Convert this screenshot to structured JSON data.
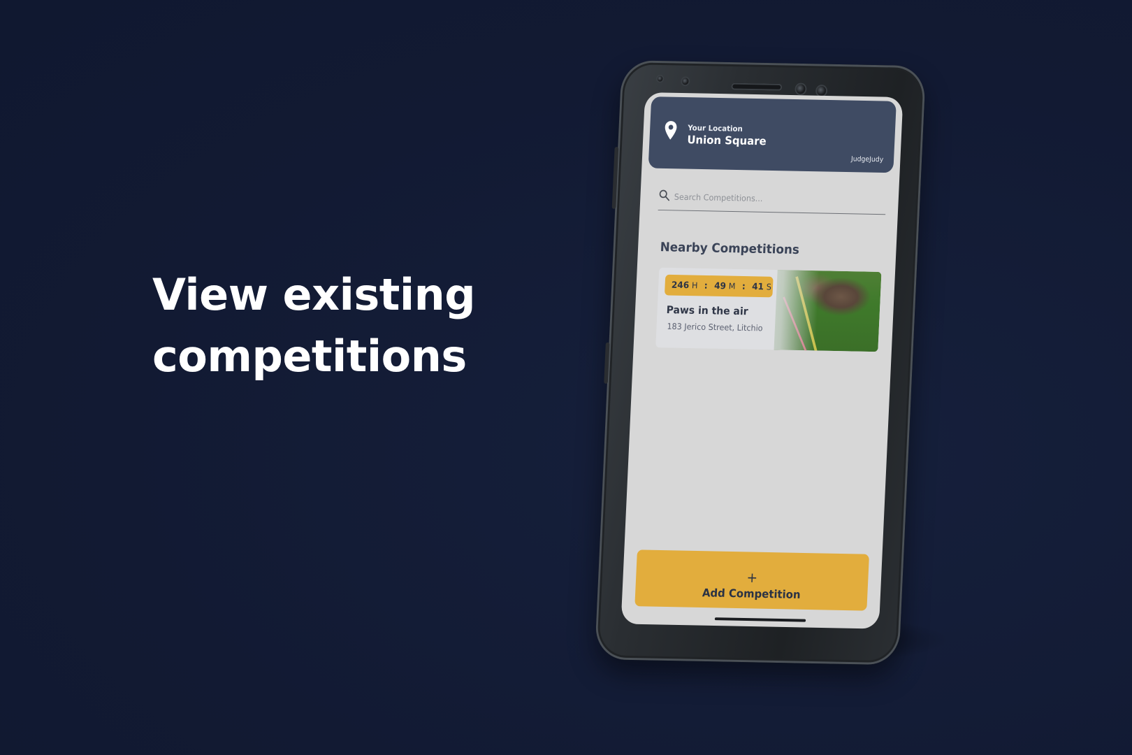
{
  "headline": {
    "line1": "View existing",
    "line2": "competitions"
  },
  "app": {
    "header": {
      "location_label": "Your Location",
      "location_name": "Union Square",
      "username": "JudgeJudy",
      "location_icon": "map-pin-icon"
    },
    "search": {
      "placeholder": "Search Competitions...",
      "value": "",
      "icon": "search-icon"
    },
    "section_title": "Nearby Competitions",
    "competitions": [
      {
        "name": "Paws in the air",
        "address": "183 Jerico Street, Litchio",
        "countdown": {
          "hours": "246",
          "hours_unit": "H",
          "minutes": "49",
          "minutes_unit": "M",
          "seconds": "41",
          "seconds_unit": "S",
          "separator": ":"
        }
      }
    ],
    "add_button": {
      "icon": "+",
      "label": "Add Competition"
    }
  },
  "colors": {
    "background": "#121a33",
    "header_card": "#3f4b63",
    "accent": "#e2ad3d",
    "screen": "#d7d7d7"
  }
}
